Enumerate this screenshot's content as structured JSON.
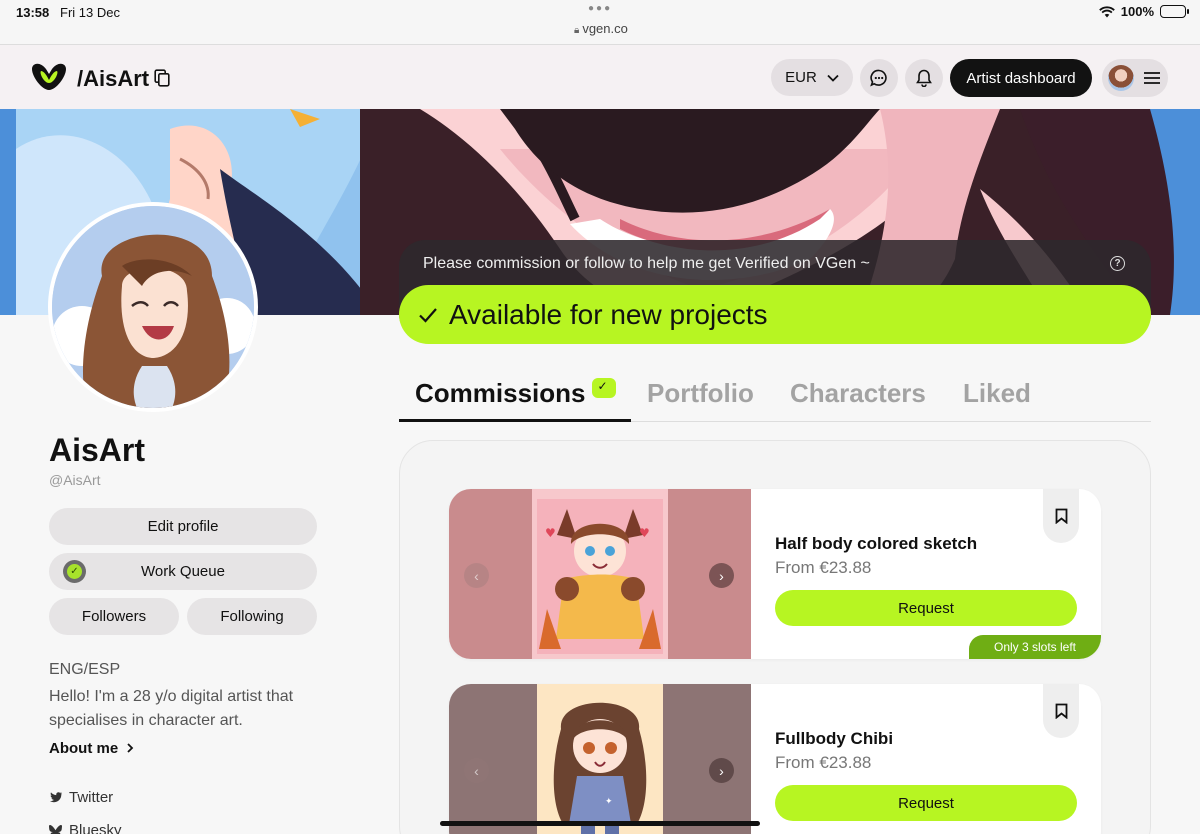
{
  "statusbar": {
    "time": "13:58",
    "date": "Fri 13 Dec",
    "url": "vgen.co",
    "battery": "100%"
  },
  "header": {
    "site_title": "/AisArt",
    "currency": "EUR",
    "dashboard_label": "Artist dashboard"
  },
  "profile": {
    "name": "AisArt",
    "handle": "@AisArt",
    "edit_label": "Edit profile",
    "work_queue_label": "Work Queue",
    "followers_label": "Followers",
    "following_label": "Following",
    "languages": "ENG/ESP",
    "bio": "Hello! I'm a 28 y/o digital artist that specialises in character art.",
    "about_label": "About me",
    "socials": [
      "Twitter",
      "Bluesky"
    ]
  },
  "verify": {
    "message": "Please commission or follow to help me get Verified on VGen ~",
    "status": "Available for new projects"
  },
  "tabs": [
    "Commissions",
    "Portfolio",
    "Characters",
    "Liked"
  ],
  "commissions": [
    {
      "title": "Half body colored sketch",
      "price": "From €23.88",
      "button": "Request",
      "badge": "Only 3 slots left"
    },
    {
      "title": "Fullbody Chibi",
      "price": "From €23.88",
      "button": "Request",
      "badge": ""
    }
  ],
  "colors": {
    "accent": "#b7f522",
    "dark": "#121212",
    "badge_green": "#6fae14"
  }
}
